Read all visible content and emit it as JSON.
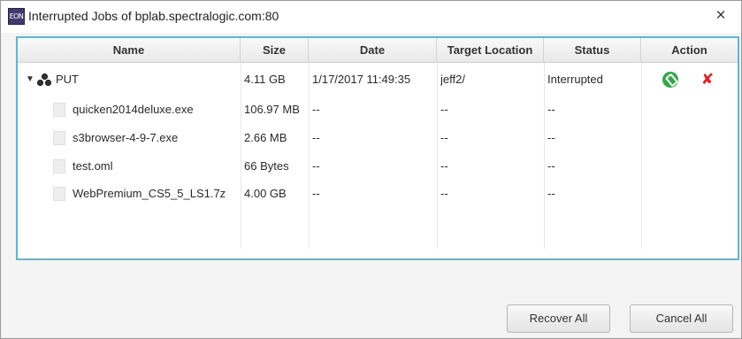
{
  "window": {
    "title": "Interrupted Jobs of bplab.spectralogic.com:80",
    "app_icon_text": "EON",
    "close_glyph": "×"
  },
  "table": {
    "headers": {
      "name": "Name",
      "size": "Size",
      "date": "Date",
      "target": "Target Location",
      "status": "Status",
      "action": "Action"
    },
    "job": {
      "toggle_glyph": "▼",
      "name": "PUT",
      "size": "4.11 GB",
      "date": "1/17/2017 11:49:35",
      "target": "jeff2/",
      "status": "Interrupted",
      "actions": {
        "recover_icon": "wrench-icon",
        "cancel_icon": "close-icon",
        "cancel_glyph": "✘"
      }
    },
    "files": [
      {
        "name": "quicken2014deluxe.exe",
        "size": "106.97 MB",
        "date": "--",
        "target": "--",
        "status": "--"
      },
      {
        "name": "s3browser-4-9-7.exe",
        "size": "2.66 MB",
        "date": "--",
        "target": "--",
        "status": "--"
      },
      {
        "name": "test.oml",
        "size": "66 Bytes",
        "date": "--",
        "target": "--",
        "status": "--"
      },
      {
        "name": "WebPremium_CS5_5_LS1.7z",
        "size": "4.00 GB",
        "date": "--",
        "target": "--",
        "status": "--"
      }
    ]
  },
  "buttons": {
    "recover_all": "Recover All",
    "cancel_all": "Cancel All"
  },
  "colors": {
    "focus_border": "#58b8e0",
    "recover_green": "#36a64c",
    "cancel_red": "#e02020"
  }
}
